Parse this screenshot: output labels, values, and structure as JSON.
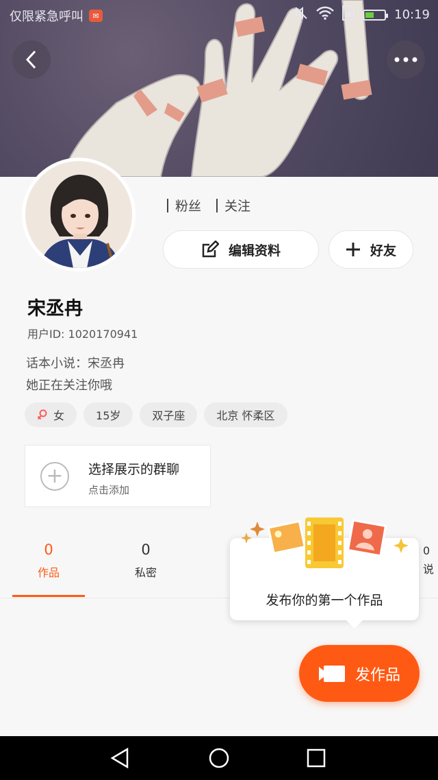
{
  "status_bar": {
    "carrier_text": "仅限紧急呼叫",
    "time": "10:19",
    "icons": [
      "mail-icon",
      "mute-icon",
      "wifi-icon",
      "sim-icon",
      "battery-icon"
    ]
  },
  "header": {
    "back_icon": "chevron-left-icon",
    "more_icon": "more-dots-icon"
  },
  "profile": {
    "fans_label": "粉丝",
    "following_label": "关注",
    "edit_label": "编辑资料",
    "add_friend_label": "好友",
    "name": "宋丞冉",
    "user_id": "用户ID: 1020170941",
    "bio_line1": "话本小说：宋丞冉",
    "bio_line2": "她正在关注你哦",
    "tags": {
      "gender": "女",
      "age": "15岁",
      "zodiac": "双子座",
      "location": "北京 怀柔区"
    }
  },
  "group_card": {
    "title": "选择展示的群聊",
    "subtitle": "点击添加"
  },
  "tabs": [
    {
      "count": "0",
      "label": "作品"
    },
    {
      "count": "0",
      "label": "私密"
    }
  ],
  "tab_partial": {
    "count": "0",
    "label": "说"
  },
  "tooltip": {
    "text": "发布你的第一个作品"
  },
  "publish_button": {
    "label": "发作品"
  },
  "colors": {
    "accent": "#ff5a14",
    "banner": "#4f4860",
    "background": "#f7f7f7"
  }
}
